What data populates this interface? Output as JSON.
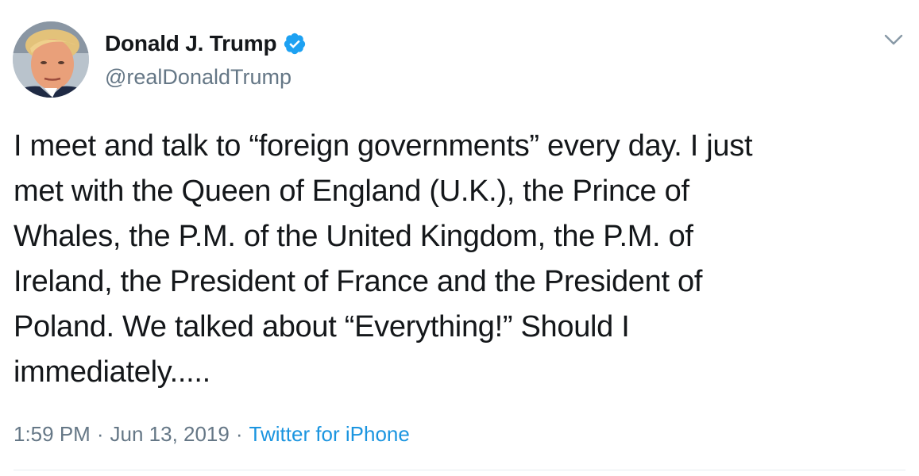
{
  "author": {
    "display_name": "Donald J. Trump",
    "handle": "@realDonaldTrump",
    "verified": true,
    "avatar_icon": "profile-photo"
  },
  "tweet": {
    "text": "I meet and talk to “foreign governments” every day. I just\nmet with the Queen of England (U.K.), the Prince of\nWhales, the P.M. of the United Kingdom, the P.M. of\nIreland, the President of France and the President of\nPoland. We talked about “Everything!” Should I\nimmediately.....",
    "time": "1:59 PM",
    "date": "Jun 13, 2019",
    "source": "Twitter for iPhone",
    "separator": "·"
  },
  "menu": {
    "icon": "chevron-down-icon"
  },
  "colors": {
    "verified_blue": "#1da1f2",
    "link_blue": "#1b95e0",
    "secondary_text": "#657786",
    "primary_text": "#14171a"
  }
}
